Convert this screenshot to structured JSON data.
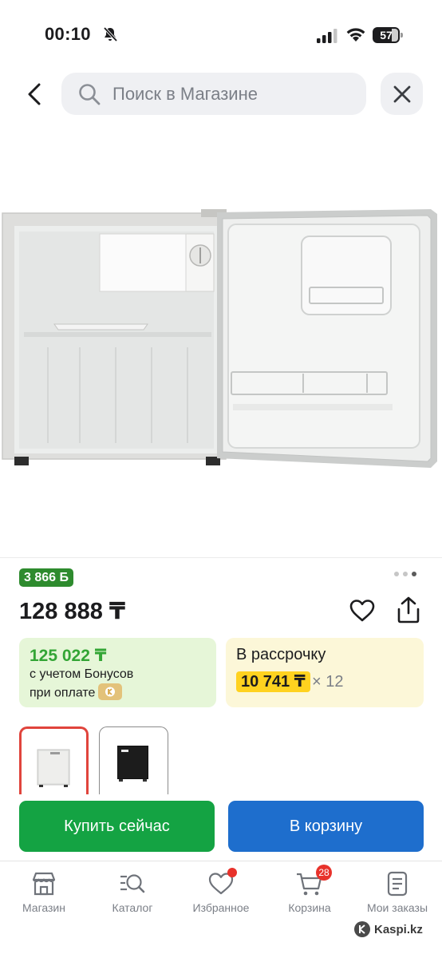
{
  "status_bar": {
    "time": "00:10",
    "battery": "57"
  },
  "search": {
    "placeholder": "Поиск в Магазине"
  },
  "product": {
    "bonus_badge": "3 866 Б",
    "price": "128 888 ₸",
    "carousel": {
      "count": 3,
      "active_index": 2
    },
    "bonus_card": {
      "price": "125 022 ₸",
      "line1": "с учетом Бонусов",
      "line2": "при оплате"
    },
    "installment_card": {
      "title": "В рассрочку",
      "amount": "10 741 ₸",
      "months": "× 12"
    },
    "thumbnails": [
      {
        "color": "white",
        "selected": true
      },
      {
        "color": "black",
        "selected": false
      }
    ]
  },
  "actions": {
    "buy_now": "Купить сейчас",
    "add_to_cart": "В корзину"
  },
  "bottom_nav": {
    "items": [
      {
        "label": "Магазин",
        "icon": "store-icon"
      },
      {
        "label": "Каталог",
        "icon": "catalog-search-icon"
      },
      {
        "label": "Избранное",
        "icon": "heart-icon",
        "has_dot": true
      },
      {
        "label": "Корзина",
        "icon": "cart-icon",
        "badge": "28"
      },
      {
        "label": "Мои заказы",
        "icon": "orders-icon"
      }
    ]
  },
  "watermark": "Kaspi.kz",
  "colors": {
    "buy_button": "#14a343",
    "cart_button": "#1e6ecd",
    "bonus_badge": "#2e8b2e",
    "bonus_price": "#33a535",
    "installment_highlight": "#ffd21f",
    "notification": "#e8322b",
    "selected_thumb_border": "#e0443c"
  }
}
